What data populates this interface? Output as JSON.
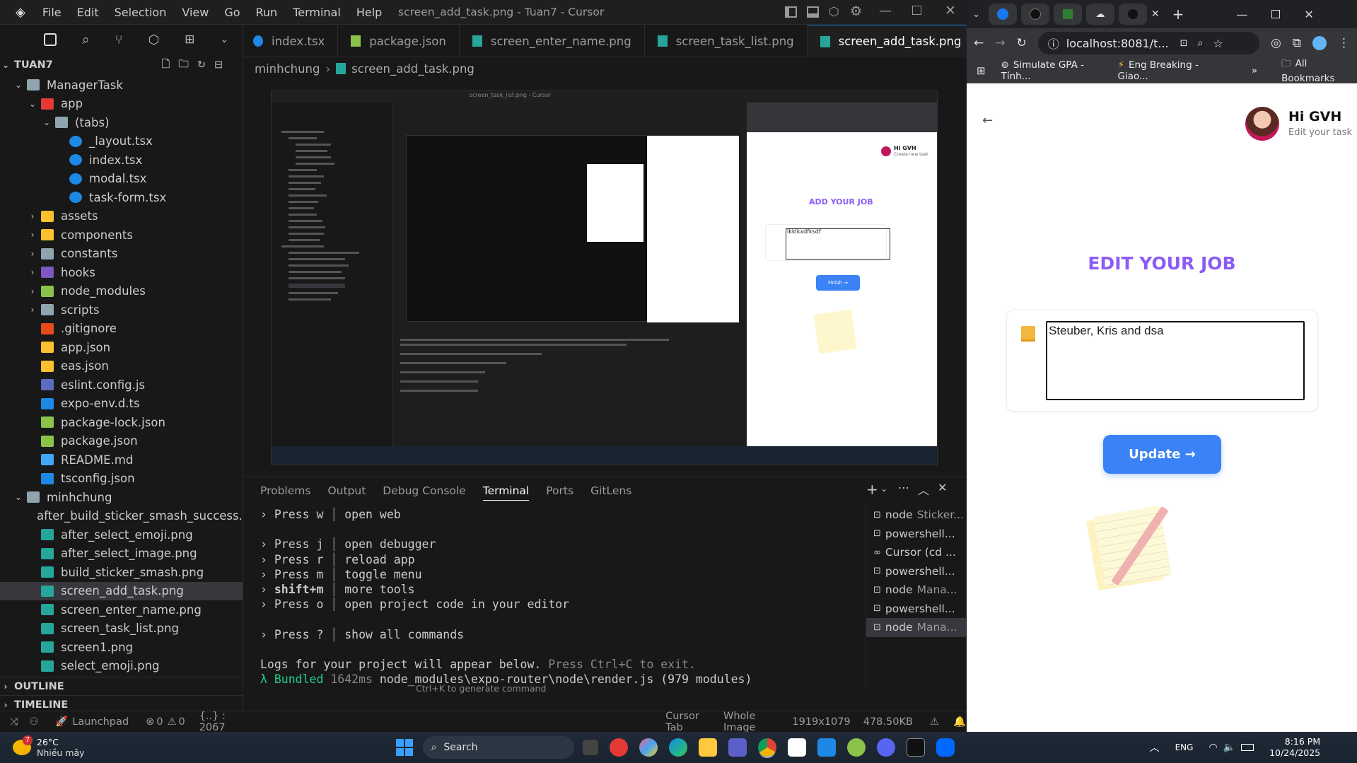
{
  "window_title": "screen_add_task.png - Tuan7 - Cursor",
  "menu": [
    "File",
    "Edit",
    "Selection",
    "View",
    "Go",
    "Run",
    "Terminal",
    "Help"
  ],
  "explorer": {
    "root": "TUAN7",
    "items": [
      {
        "label": "ManagerTask",
        "depth": 0,
        "type": "folder",
        "open": true
      },
      {
        "label": "app",
        "depth": 1,
        "type": "folder-app",
        "open": true
      },
      {
        "label": "(tabs)",
        "depth": 2,
        "type": "folder",
        "open": true
      },
      {
        "label": "_layout.tsx",
        "depth": 3,
        "type": "tsx"
      },
      {
        "label": "index.tsx",
        "depth": 3,
        "type": "tsx"
      },
      {
        "label": "modal.tsx",
        "depth": 3,
        "type": "tsx"
      },
      {
        "label": "task-form.tsx",
        "depth": 3,
        "type": "tsx"
      },
      {
        "label": "assets",
        "depth": 1,
        "type": "folder-assets",
        "open": false
      },
      {
        "label": "components",
        "depth": 1,
        "type": "folder-components",
        "open": false
      },
      {
        "label": "constants",
        "depth": 1,
        "type": "folder",
        "open": false
      },
      {
        "label": "hooks",
        "depth": 1,
        "type": "folder-hooks",
        "open": false
      },
      {
        "label": "node_modules",
        "depth": 1,
        "type": "folder-node",
        "open": false
      },
      {
        "label": "scripts",
        "depth": 1,
        "type": "folder",
        "open": false
      },
      {
        "label": ".gitignore",
        "depth": 1,
        "type": "git"
      },
      {
        "label": "app.json",
        "depth": 1,
        "type": "json"
      },
      {
        "label": "eas.json",
        "depth": 1,
        "type": "json"
      },
      {
        "label": "eslint.config.js",
        "depth": 1,
        "type": "eslint"
      },
      {
        "label": "expo-env.d.ts",
        "depth": 1,
        "type": "ts"
      },
      {
        "label": "package-lock.json",
        "depth": 1,
        "type": "npm"
      },
      {
        "label": "package.json",
        "depth": 1,
        "type": "npm"
      },
      {
        "label": "README.md",
        "depth": 1,
        "type": "info"
      },
      {
        "label": "tsconfig.json",
        "depth": 1,
        "type": "tsconfig"
      },
      {
        "label": "minhchung",
        "depth": 0,
        "type": "folder",
        "open": true
      },
      {
        "label": "after_build_sticker_smash_success.png",
        "depth": 1,
        "type": "png"
      },
      {
        "label": "after_select_emoji.png",
        "depth": 1,
        "type": "png"
      },
      {
        "label": "after_select_image.png",
        "depth": 1,
        "type": "png"
      },
      {
        "label": "build_sticker_smash.png",
        "depth": 1,
        "type": "png"
      },
      {
        "label": "screen_add_task.png",
        "depth": 1,
        "type": "png",
        "selected": true
      },
      {
        "label": "screen_enter_name.png",
        "depth": 1,
        "type": "png"
      },
      {
        "label": "screen_task_list.png",
        "depth": 1,
        "type": "png"
      },
      {
        "label": "screen1.png",
        "depth": 1,
        "type": "png"
      },
      {
        "label": "select_emoji.png",
        "depth": 1,
        "type": "png"
      }
    ],
    "outline": "OUTLINE",
    "timeline": "TIMELINE"
  },
  "tabs": [
    {
      "label": "index.tsx",
      "icon": "react"
    },
    {
      "label": "package.json",
      "icon": "npm"
    },
    {
      "label": "screen_enter_name.png",
      "icon": "png"
    },
    {
      "label": "screen_task_list.png",
      "icon": "png"
    },
    {
      "label": "screen_add_task.png",
      "icon": "png",
      "active": true
    }
  ],
  "breadcrumb": {
    "folder": "minhchung",
    "file": "screen_add_task.png"
  },
  "nested_preview": {
    "title": "screen_task_list.png - Cursor",
    "heading": "ADD YOUR JOB",
    "input_value": "lkklkxdfksdf",
    "button": "Finish →",
    "greeting": "Hi GVH",
    "subtitle": "Create new task"
  },
  "panel": {
    "tabs": [
      "Problems",
      "Output",
      "Debug Console",
      "Terminal",
      "Ports",
      "GitLens"
    ],
    "active_tab": "Terminal",
    "lines": [
      {
        "key": "Press w",
        "desc": "open web"
      },
      {
        "key": "",
        "desc": ""
      },
      {
        "key": "Press j",
        "desc": "open debugger"
      },
      {
        "key": "Press r",
        "desc": "reload app"
      },
      {
        "key": "Press m",
        "desc": "toggle menu"
      },
      {
        "key": "shift+m",
        "desc": "more tools"
      },
      {
        "key": "Press o",
        "desc": "open project code in your editor"
      },
      {
        "key": "",
        "desc": ""
      },
      {
        "key": "Press ?",
        "desc": "show all commands"
      }
    ],
    "logs_line": "Logs for your project will appear below.",
    "logs_hint": "Press Ctrl+C to exit.",
    "bundled_prefix": "λ Bundled",
    "bundled_time": "1642ms",
    "bundled_rest": "node_modules\\expo-router\\node\\render.js (979 modules)",
    "generate_hint": "Ctrl+K to generate command",
    "terminals": [
      {
        "label": "node",
        "detail": "Sticker..."
      },
      {
        "label": "powershell...",
        "detail": ""
      },
      {
        "label": "Cursor (cd ...",
        "detail": ""
      },
      {
        "label": "powershell...",
        "detail": ""
      },
      {
        "label": "node",
        "detail": "Mana..."
      },
      {
        "label": "powershell...",
        "detail": ""
      },
      {
        "label": "node",
        "detail": "Mana...",
        "selected": true
      }
    ]
  },
  "statusbar": {
    "launchpad": "Launchpad",
    "errors": "0",
    "warnings": "0",
    "position": "{..} : 2067",
    "cursor_tab": "Cursor Tab",
    "whole_image": "Whole Image",
    "dimensions": "1919x1079",
    "size": "478.50KB"
  },
  "browser": {
    "url": "localhost:8081/t...",
    "bookmarks": [
      "Simulate GPA - Tính...",
      "Eng Breaking - Giao..."
    ],
    "all_bookmarks": "All Bookmarks",
    "greeting": "Hi GVH",
    "subtitle": "Edit your task",
    "heading": "EDIT YOUR JOB",
    "input_value": "Steuber, Kris and dsa",
    "button": "Update →",
    "accent": "#3b82f6",
    "heading_color": "#8b5cf6"
  },
  "taskbar": {
    "weather_temp": "26°C",
    "weather_desc": "Nhiều mây",
    "weather_badge": "7",
    "search": "Search",
    "lang": "ENG",
    "time": "8:16 PM",
    "date": "10/24/2025"
  }
}
